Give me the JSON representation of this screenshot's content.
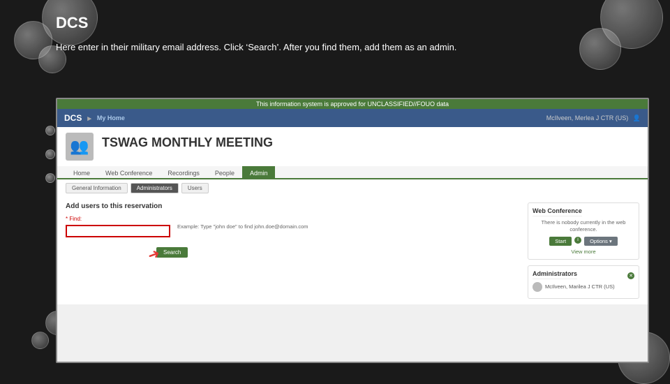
{
  "slide": {
    "title": "DCS",
    "description": "Here enter in their military email address. Click ‘Search’. After you find them, add them as an admin."
  },
  "app": {
    "banner": "This information system is approved for UNCLASSIFIED//FOUO data",
    "name": "DCS",
    "home_link": "My Home",
    "user": "McIlveen, Merlea J CTR (US)"
  },
  "meeting": {
    "title": "TSWAG MONTHLY MEETING"
  },
  "nav_tabs": [
    {
      "label": "Home",
      "active": false
    },
    {
      "label": "Web Conference",
      "active": false
    },
    {
      "label": "Recordings",
      "active": false
    },
    {
      "label": "People",
      "active": false
    },
    {
      "label": "Admin",
      "active": true
    }
  ],
  "sub_tabs": [
    {
      "label": "General Information",
      "active": false
    },
    {
      "label": "Administrators",
      "active": true
    },
    {
      "label": "Users",
      "active": false
    }
  ],
  "form": {
    "section_title": "Add users to this reservation",
    "label": "* Find:",
    "placeholder": "",
    "hint": "Example: Type \"john doe\" to find john.doe@domain.com",
    "search_button": "Search"
  },
  "web_conference": {
    "title": "Web Conference",
    "status_text": "There is nobody currently in the web conference.",
    "start_button": "Start",
    "options_button": "Options ▾",
    "view_more": "View more"
  },
  "administrators": {
    "title": "Administrators",
    "items": [
      {
        "name": "McIlveen, Marilea J CTR (US)"
      }
    ]
  }
}
